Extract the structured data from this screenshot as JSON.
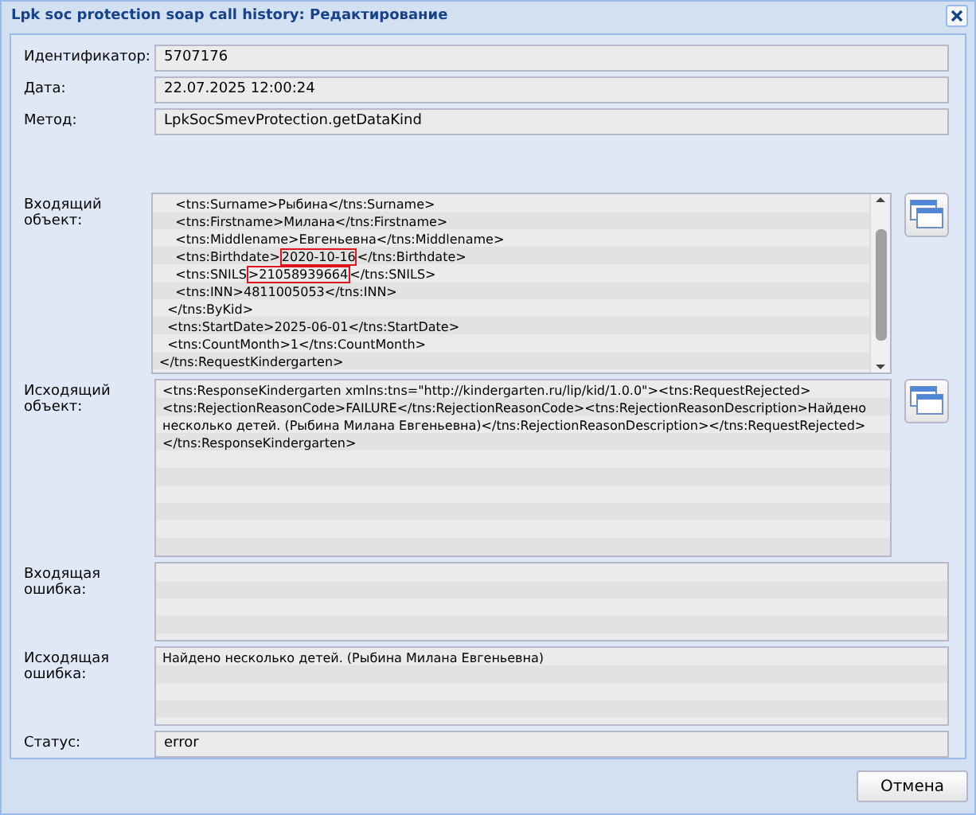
{
  "window": {
    "title": "Lpk soc protection soap call history: Редактирование"
  },
  "fields": [
    {
      "label": "Идентификатор:",
      "value": "5707176"
    },
    {
      "label": "Дата:",
      "value": "22.07.2025 12:00:24"
    },
    {
      "label": "Метод:",
      "value": "LpkSocSmevProtection.getDataKind"
    }
  ],
  "incoming_object": {
    "label": "Входящий объект:",
    "lines": [
      [
        {
          "text": "    <tns:Surname>Рыбина</tns:Surname>",
          "highlighted": false
        }
      ],
      [
        {
          "text": "    <tns:Firstname>Милана</tns:Firstname>",
          "highlighted": false
        }
      ],
      [
        {
          "text": "    <tns:Middlename>Евгеньевна</tns:Middlename>",
          "highlighted": false
        }
      ],
      [
        {
          "text": "    <tns:Birthdate>",
          "highlighted": false
        },
        {
          "text": "2020-10-16",
          "highlighted": true
        },
        {
          "text": "</tns:Birthdate>",
          "highlighted": false
        }
      ],
      [
        {
          "text": "    <tns:SNILS",
          "highlighted": false
        },
        {
          "text": ">21058939664",
          "highlighted": true
        },
        {
          "text": "</tns:SNILS>",
          "highlighted": false
        }
      ],
      [
        {
          "text": "    <tns:INN>4811005053</tns:INN>",
          "highlighted": false
        }
      ],
      [
        {
          "text": "  </tns:ByKid>",
          "highlighted": false
        }
      ],
      [
        {
          "text": "  <tns:StartDate>2025-06-01</tns:StartDate>",
          "highlighted": false
        }
      ],
      [
        {
          "text": "  <tns:CountMonth>1</tns:CountMonth>",
          "highlighted": false
        }
      ],
      [
        {
          "text": "</tns:RequestKindergarten>",
          "highlighted": false
        }
      ]
    ]
  },
  "outgoing_object": {
    "label": "Исходящий объект:",
    "value": "<tns:ResponseKindergarten xmlns:tns=\"http://kindergarten.ru/lip/kid/1.0.0\"><tns:RequestRejected><tns:RejectionReasonCode>FAILURE</tns:RejectionReasonCode><tns:RejectionReasonDescription>Найдено несколько детей. (Рыбина Милана Евгеньевна)</tns:RejectionReasonDescription></tns:RequestRejected></tns:ResponseKindergarten>"
  },
  "incoming_error": {
    "label": "Входящая ошибка:"
  },
  "outgoing_error": {
    "label": "Исходящая ошибка:",
    "value": "Найдено несколько детей. (Рыбина Милана Евгеньевна)"
  },
  "status": {
    "label": "Статус:",
    "value": "error"
  },
  "buttons": [
    "Отмена"
  ]
}
